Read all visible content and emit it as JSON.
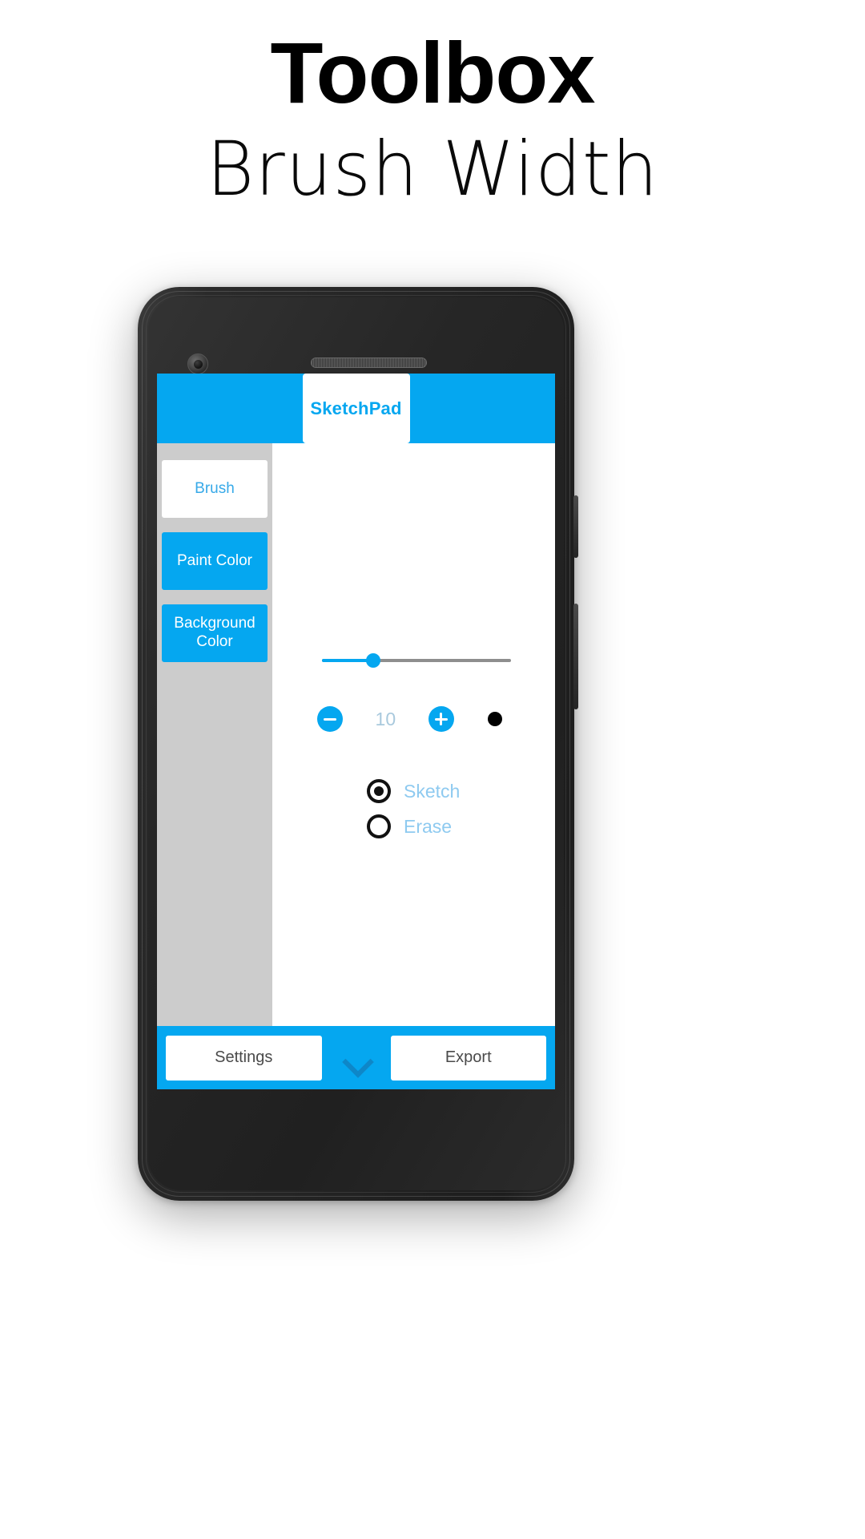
{
  "promo": {
    "title": "Toolbox",
    "subtitle": "Brush Width"
  },
  "device": {
    "icons": {
      "front_camera": "camera-icon",
      "earpiece": "speaker-grille-icon",
      "sensor": "proximity-sensor-icon",
      "power_button": "power-button",
      "volume_button": "volume-button"
    }
  },
  "app": {
    "header": {
      "title": "SketchPad"
    },
    "sidebar": {
      "items": [
        {
          "label": "Brush",
          "active": true
        },
        {
          "label": "Paint Color",
          "active": false
        },
        {
          "label": "Background Color",
          "active": false
        }
      ]
    },
    "brush_panel": {
      "slider": {
        "name": "brush-width-slider",
        "min": 1,
        "max": 40,
        "value": 10,
        "fill_percent": 27
      },
      "stepper": {
        "decrement_icon": "minus-icon",
        "increment_icon": "plus-icon",
        "value": "10"
      },
      "preview": {
        "icon": "brush-dot-preview",
        "color": "#000000"
      },
      "modes": [
        {
          "label": "Sketch",
          "selected": true
        },
        {
          "label": "Erase",
          "selected": false
        }
      ]
    },
    "bottom_bar": {
      "settings_label": "Settings",
      "expand_icon": "chevron-down-icon",
      "export_label": "Export"
    },
    "colors": {
      "accent": "#05a7f0",
      "sidebar_bg": "#cccccc",
      "panel_bg": "#ffffff",
      "slider_track": "#8e8e8e",
      "value_text": "#a9c9dd",
      "radio_label": "#8ecaf0",
      "bottom_btn_text": "#4a4a4a"
    }
  }
}
